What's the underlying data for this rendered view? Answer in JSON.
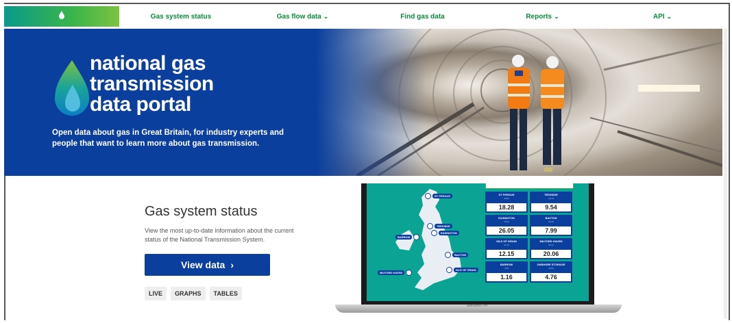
{
  "nav": {
    "items": [
      {
        "label": "Gas system status",
        "dropdown": false
      },
      {
        "label": "Gas flow data",
        "dropdown": true
      },
      {
        "label": "Find gas data",
        "dropdown": false
      },
      {
        "label": "Reports",
        "dropdown": true
      },
      {
        "label": "API",
        "dropdown": true
      }
    ],
    "logo_icon": "flame-icon",
    "accent": "#3ab54a"
  },
  "hero": {
    "brand_line1": "national gas",
    "brand_line2": "transmission",
    "brand_line3": "data portal",
    "tagline": "Open data about gas in Great Britain, for industry experts and people that want to learn more about gas transmission.",
    "background": "#0a3f9e"
  },
  "status": {
    "title": "Gas system status",
    "description": "View the most up-to-date information about the current status of the National Transmission System.",
    "button_label": "View data",
    "button_icon": "chevron-right-icon",
    "tags": [
      "LIVE",
      "GRAPHS",
      "TABLES"
    ]
  },
  "laptop": {
    "model": "MacBook Pro",
    "map_pins": [
      "ST FERGUS",
      "TEESSIDE",
      "EASINGTON",
      "BARROW",
      "BACTON",
      "ISLE OF GRAIN",
      "MILFORD HAVEN"
    ],
    "terminals": [
      {
        "name": "ST FERGUS",
        "sub": "33.82",
        "value": "18.28"
      },
      {
        "name": "TEESSIDE",
        "sub": "29.13",
        "value": "9.54"
      },
      {
        "name": "EASINGTON",
        "sub": "79.34",
        "value": "26.05"
      },
      {
        "name": "BACTON",
        "sub": "24.40",
        "value": "7.99"
      },
      {
        "name": "ISLE OF GRAIN",
        "sub": "37.12",
        "value": "12.15"
      },
      {
        "name": "MILFORD HAVEN",
        "sub": "61.24",
        "value": "20.06"
      },
      {
        "name": "BARROW",
        "sub": "3.56",
        "value": "1.16"
      },
      {
        "name": "ONSHORE STORAGE",
        "sub": "14.53",
        "value": "4.76"
      }
    ]
  }
}
